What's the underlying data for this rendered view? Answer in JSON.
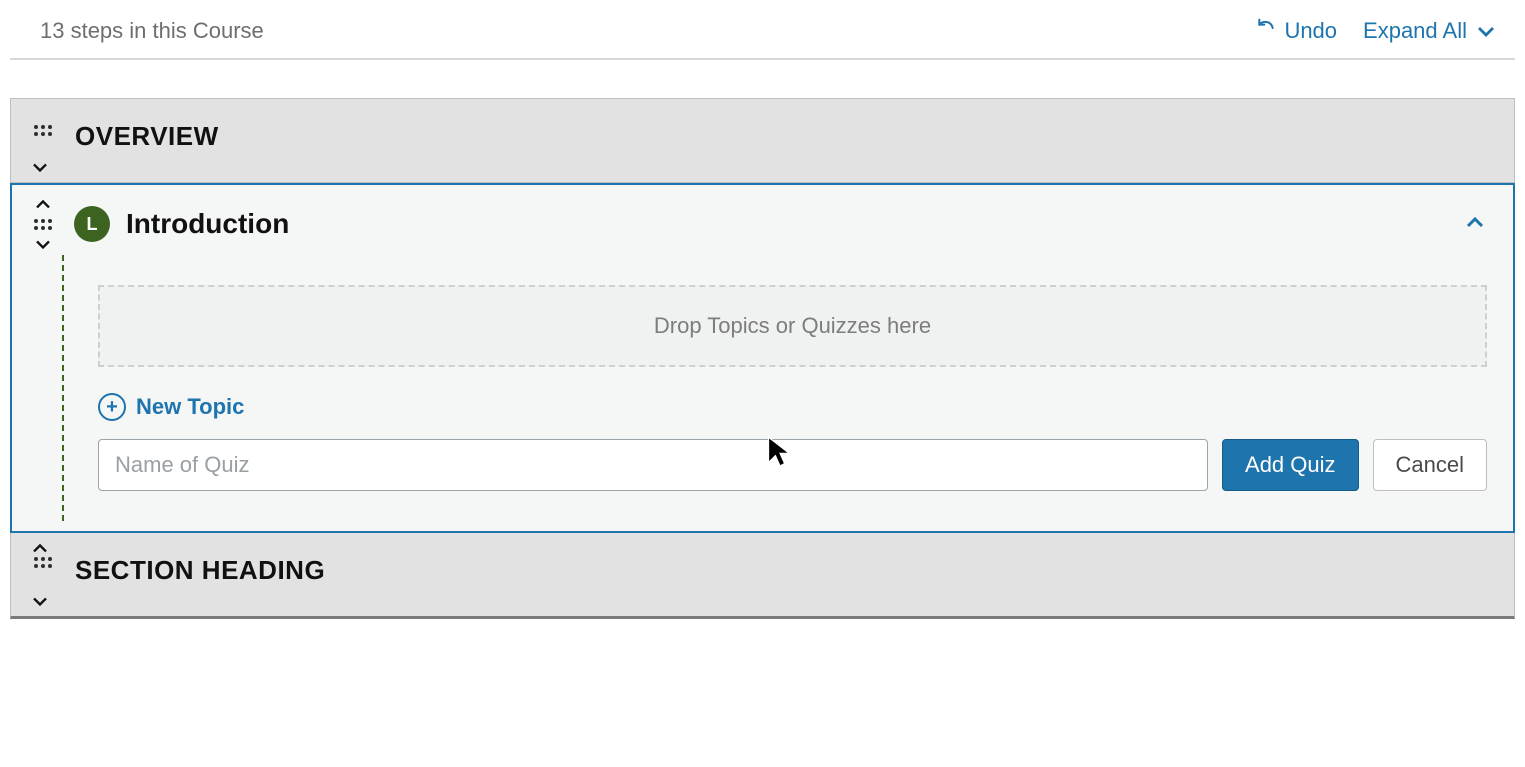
{
  "topbar": {
    "step_count_text": "13 steps in this Course",
    "undo_label": "Undo",
    "expand_all_label": "Expand All"
  },
  "sections": {
    "overview": {
      "title": "OVERVIEW"
    },
    "introduction": {
      "icon_letter": "L",
      "title": "Introduction",
      "dropzone_text": "Drop Topics or Quizzes here",
      "new_topic_label": "New Topic",
      "quiz_placeholder": "Name of Quiz",
      "add_quiz_label": "Add Quiz",
      "cancel_label": "Cancel"
    },
    "section_heading": {
      "title": "SECTION HEADING"
    }
  },
  "colors": {
    "accent": "#1e74ad",
    "lesson_badge": "#3d6321",
    "panel_bg": "#e2e2e2"
  }
}
